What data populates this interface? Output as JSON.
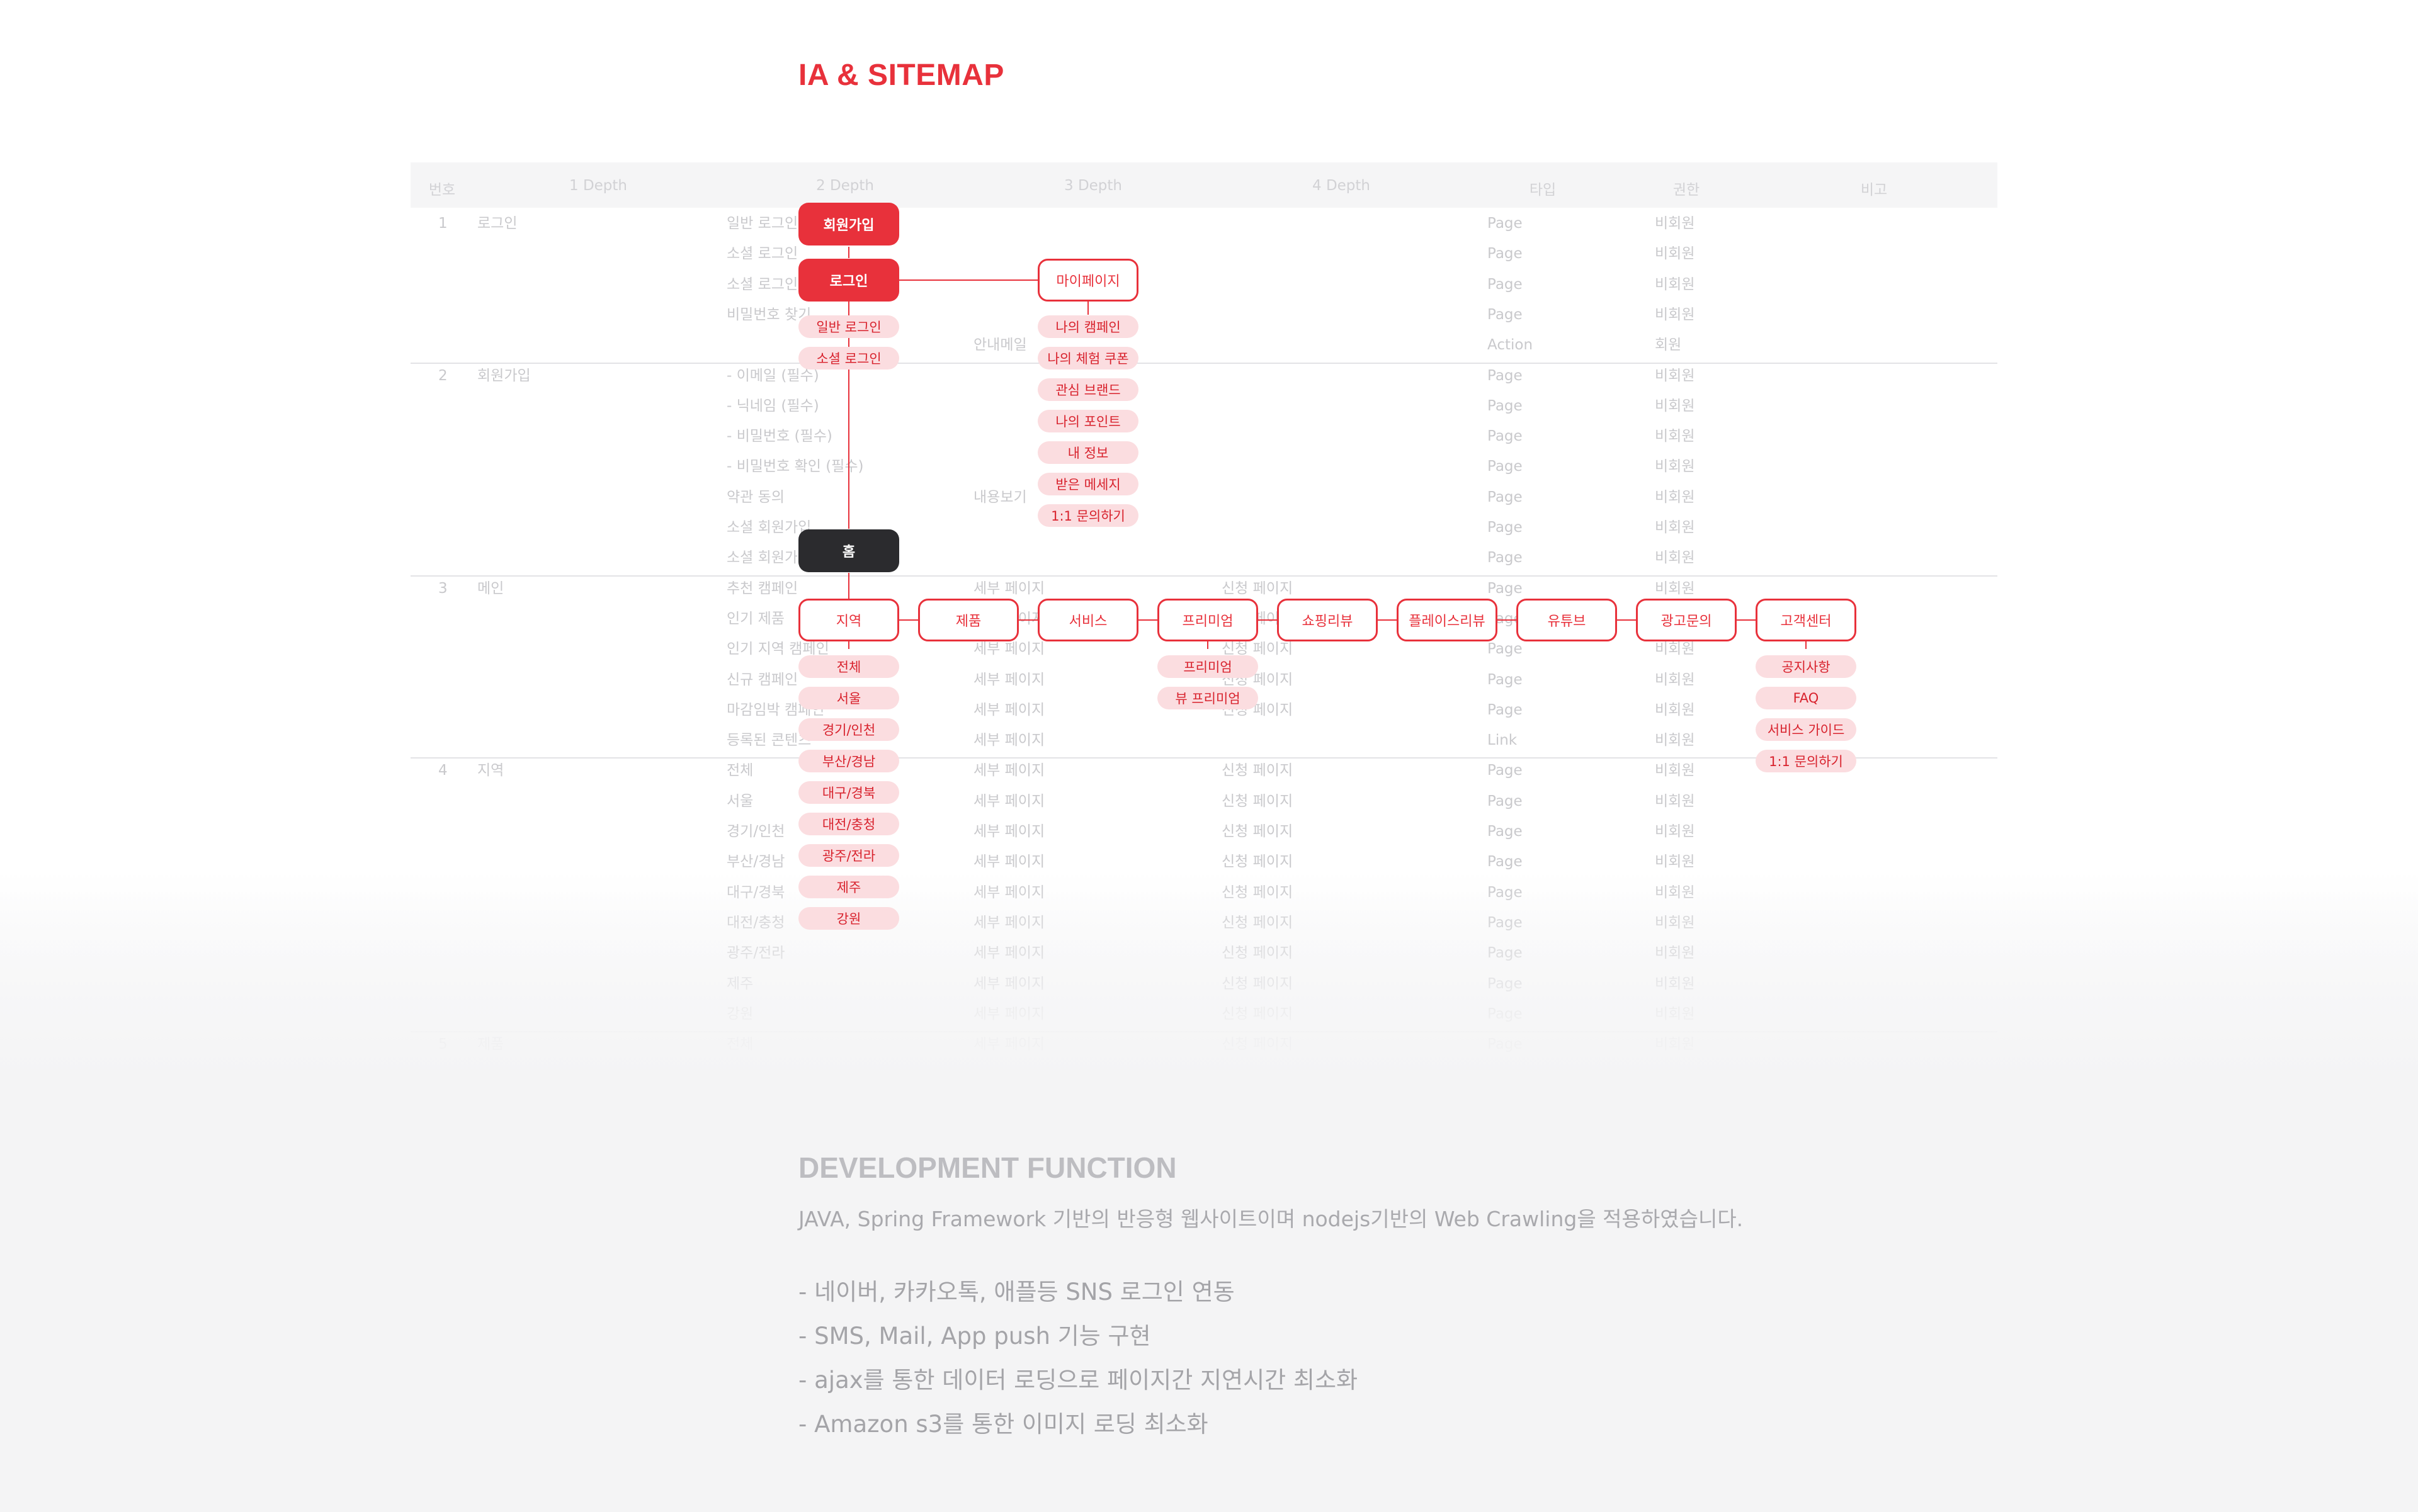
{
  "title": "IA & SITEMAP",
  "colors": {
    "accent": "#e8313b",
    "pill_bg": "#fbdde0",
    "dark": "#2b2b2e",
    "muted": "#a4a4a8"
  },
  "table": {
    "headers": [
      "번호",
      "1 Depth",
      "2 Depth",
      "3 Depth",
      "4 Depth",
      "타입",
      "권한",
      "비고"
    ],
    "rows": [
      {
        "no": "1",
        "d1": "로그인",
        "d2": "일반 로그인",
        "d3": "",
        "d4": "",
        "type": "Page",
        "perm": "비회원"
      },
      {
        "no": "",
        "d1": "",
        "d2": "소셜 로그인",
        "d3": "",
        "d4": "",
        "type": "Page",
        "perm": "비회원"
      },
      {
        "no": "",
        "d1": "",
        "d2": "소셜 로그인",
        "d3": "",
        "d4": "",
        "type": "Page",
        "perm": "비회원"
      },
      {
        "no": "",
        "d1": "",
        "d2": "비밀번호 찾기",
        "d3": "",
        "d4": "",
        "type": "Page",
        "perm": "비회원"
      },
      {
        "no": "",
        "d1": "",
        "d2": "",
        "d3": "안내메일",
        "d4": "",
        "type": "Action",
        "perm": "회원"
      },
      {
        "no": "2",
        "d1": "회원가입",
        "d2": "- 이메일 (필수)",
        "d3": "",
        "d4": "",
        "type": "Page",
        "perm": "비회원"
      },
      {
        "no": "",
        "d1": "",
        "d2": "- 닉네임 (필수)",
        "d3": "",
        "d4": "",
        "type": "Page",
        "perm": "비회원"
      },
      {
        "no": "",
        "d1": "",
        "d2": "- 비밀번호 (필수)",
        "d3": "",
        "d4": "",
        "type": "Page",
        "perm": "비회원"
      },
      {
        "no": "",
        "d1": "",
        "d2": "- 비밀번호 확인 (필수)",
        "d3": "",
        "d4": "",
        "type": "Page",
        "perm": "비회원"
      },
      {
        "no": "",
        "d1": "",
        "d2": "약관 동의",
        "d3": "내용보기",
        "d4": "",
        "type": "Page",
        "perm": "비회원"
      },
      {
        "no": "",
        "d1": "",
        "d2": "소셜 회원가입",
        "d3": "",
        "d4": "",
        "type": "Page",
        "perm": "비회원"
      },
      {
        "no": "",
        "d1": "",
        "d2": "소셜 회원가입",
        "d3": "",
        "d4": "",
        "type": "Page",
        "perm": "비회원"
      },
      {
        "no": "3",
        "d1": "메인",
        "d2": "추천 캠페인",
        "d3": "세부 페이지",
        "d4": "신청 페이지",
        "type": "Page",
        "perm": "비회원"
      },
      {
        "no": "",
        "d1": "",
        "d2": "인기 제품",
        "d3": "세부 페이지",
        "d4": "신청 페이지",
        "type": "Page",
        "perm": "비회원"
      },
      {
        "no": "",
        "d1": "",
        "d2": "인기 지역 캠페인",
        "d3": "세부 페이지",
        "d4": "신청 페이지",
        "type": "Page",
        "perm": "비회원"
      },
      {
        "no": "",
        "d1": "",
        "d2": "신규 캠페인",
        "d3": "세부 페이지",
        "d4": "신청 페이지",
        "type": "Page",
        "perm": "비회원"
      },
      {
        "no": "",
        "d1": "",
        "d2": "마감임박 캠페인",
        "d3": "세부 페이지",
        "d4": "신청 페이지",
        "type": "Page",
        "perm": "비회원"
      },
      {
        "no": "",
        "d1": "",
        "d2": "등록된 콘텐츠",
        "d3": "세부 페이지",
        "d4": "",
        "type": "Link",
        "perm": "비회원"
      },
      {
        "no": "4",
        "d1": "지역",
        "d2": "전체",
        "d3": "세부 페이지",
        "d4": "신청 페이지",
        "type": "Page",
        "perm": "비회원"
      },
      {
        "no": "",
        "d1": "",
        "d2": "서울",
        "d3": "세부 페이지",
        "d4": "신청 페이지",
        "type": "Page",
        "perm": "비회원"
      },
      {
        "no": "",
        "d1": "",
        "d2": "경기/인천",
        "d3": "세부 페이지",
        "d4": "신청 페이지",
        "type": "Page",
        "perm": "비회원"
      },
      {
        "no": "",
        "d1": "",
        "d2": "부산/경남",
        "d3": "세부 페이지",
        "d4": "신청 페이지",
        "type": "Page",
        "perm": "비회원"
      },
      {
        "no": "",
        "d1": "",
        "d2": "대구/경북",
        "d3": "세부 페이지",
        "d4": "신청 페이지",
        "type": "Page",
        "perm": "비회원"
      },
      {
        "no": "",
        "d1": "",
        "d2": "대전/충청",
        "d3": "세부 페이지",
        "d4": "신청 페이지",
        "type": "Page",
        "perm": "비회원"
      },
      {
        "no": "",
        "d1": "",
        "d2": "광주/전라",
        "d3": "세부 페이지",
        "d4": "신청 페이지",
        "type": "Page",
        "perm": "비회원"
      },
      {
        "no": "",
        "d1": "",
        "d2": "제주",
        "d3": "세부 페이지",
        "d4": "신청 페이지",
        "type": "Page",
        "perm": "비회원"
      },
      {
        "no": "",
        "d1": "",
        "d2": "강원",
        "d3": "세부 페이지",
        "d4": "신청 페이지",
        "type": "Page",
        "perm": "비회원"
      },
      {
        "no": "5",
        "d1": "제품",
        "d2": "전체",
        "d3": "세부 페이지",
        "d4": "신청 페이지",
        "type": "Page",
        "perm": "비회원"
      }
    ]
  },
  "sitemap": {
    "signup": "회원가입",
    "login": "로그인",
    "login_children": [
      "일반 로그인",
      "소셜 로그인"
    ],
    "mypage": "마이페이지",
    "mypage_children": [
      "나의 캠페인",
      "나의 체험 쿠폰",
      "관심 브랜드",
      "나의 포인트",
      "내 정보",
      "받은 메세지",
      "1:1 문의하기"
    ],
    "home": "홈",
    "menu": [
      "지역",
      "제품",
      "서비스",
      "프리미엄",
      "쇼핑리뷰",
      "플레이스리뷰",
      "유튜브",
      "광고문의",
      "고객센터"
    ],
    "region_children": [
      "전체",
      "서울",
      "경기/인천",
      "부산/경남",
      "대구/경북",
      "대전/충청",
      "광주/전라",
      "제주",
      "강원"
    ],
    "premium_children": [
      "프리미엄",
      "뷰 프리미엄"
    ],
    "support_children": [
      "공지사항",
      "FAQ",
      "서비스 가이드",
      "1:1 문의하기"
    ]
  },
  "dev": {
    "title": "DEVELOPMENT FUNCTION",
    "description": "JAVA, Spring Framework 기반의 반응형 웹사이트이며 nodejs기반의 Web Crawling을 적용하였습니다.",
    "items": [
      "- 네이버, 카카오톡, 애플등 SNS 로그인 연동",
      "- SMS, Mail, App push 기능 구현",
      "- ajax를 통한 데이터 로딩으로 페이지간 지연시간 최소화",
      "- Amazon s3를 통한 이미지 로딩 최소화"
    ]
  }
}
